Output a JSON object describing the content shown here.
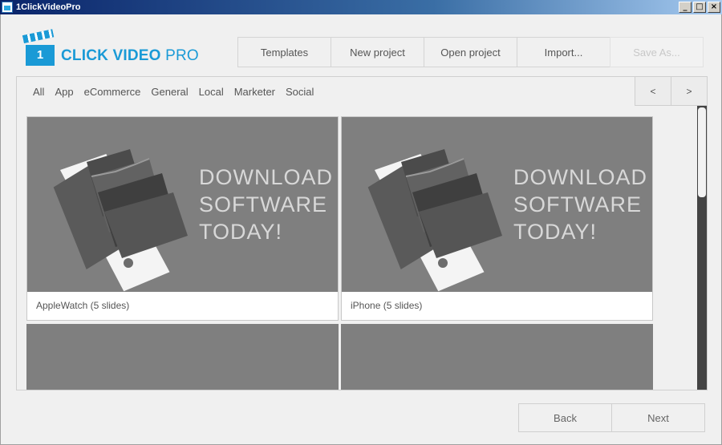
{
  "window": {
    "title": "1ClickVideoPro",
    "controls": [
      "_",
      "□",
      "×"
    ]
  },
  "logo": {
    "number": "1",
    "text_bold": "CLICK VIDEO",
    "text_light": "PRO"
  },
  "toolbar": {
    "templates": "Templates",
    "new_project": "New project",
    "open_project": "Open project",
    "import": "Import...",
    "save_as": "Save As..."
  },
  "filters": [
    "All",
    "App",
    "eCommerce",
    "General",
    "Local",
    "Marketer",
    "Social"
  ],
  "nav": {
    "prev": "<",
    "next": ">"
  },
  "templates": [
    {
      "name": "AppleWatch (5 slides)",
      "promo": [
        "DOWNLOAD",
        "SOFTWARE",
        "TODAY!"
      ]
    },
    {
      "name": "iPhone (5 slides)",
      "promo": [
        "DOWNLOAD",
        "SOFTWARE",
        "TODAY!"
      ]
    }
  ],
  "footer": {
    "back": "Back",
    "next": "Next"
  },
  "colors": {
    "brand": "#1a9ad6",
    "thumb_bg": "#7f7f7f"
  }
}
